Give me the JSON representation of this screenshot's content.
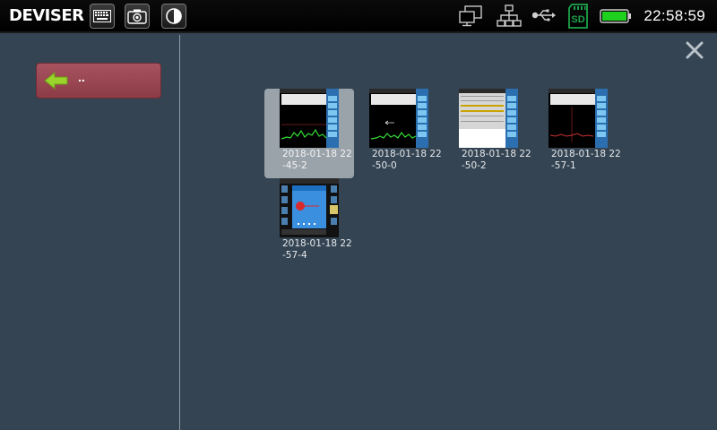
{
  "app": {
    "logo_text": "DEVISER",
    "clock": "22:58:59"
  },
  "toolbar": {
    "buttons": [
      {
        "icon": "keyboard-icon"
      },
      {
        "icon": "camera-icon"
      },
      {
        "icon": "contrast-icon"
      }
    ]
  },
  "status": {
    "icons": [
      "remote-desktop-icon",
      "network-icon",
      "usb-icon",
      "sd-card-icon",
      "battery-icon"
    ],
    "sd_label": "SD"
  },
  "nav": {
    "back_label": "..",
    "close_icon": "close-icon"
  },
  "files": [
    {
      "name": "2018-01-18 22-45-2",
      "selected": true,
      "kind": "spectrum-green"
    },
    {
      "name": "2018-01-18 22-50-0",
      "selected": false,
      "kind": "spectrum-green"
    },
    {
      "name": "2018-01-18 22-50-2",
      "selected": false,
      "kind": "table"
    },
    {
      "name": "2018-01-18 22-57-1",
      "selected": false,
      "kind": "spectrum-red"
    },
    {
      "name": "2018-01-18 22-57-4",
      "selected": false,
      "kind": "dialog"
    }
  ],
  "colors": {
    "background": "#344452",
    "back_button": "#9a4552",
    "selection": "#9aa3aa",
    "battery": "#1fd11f",
    "sd_card": "#1ca34a"
  }
}
